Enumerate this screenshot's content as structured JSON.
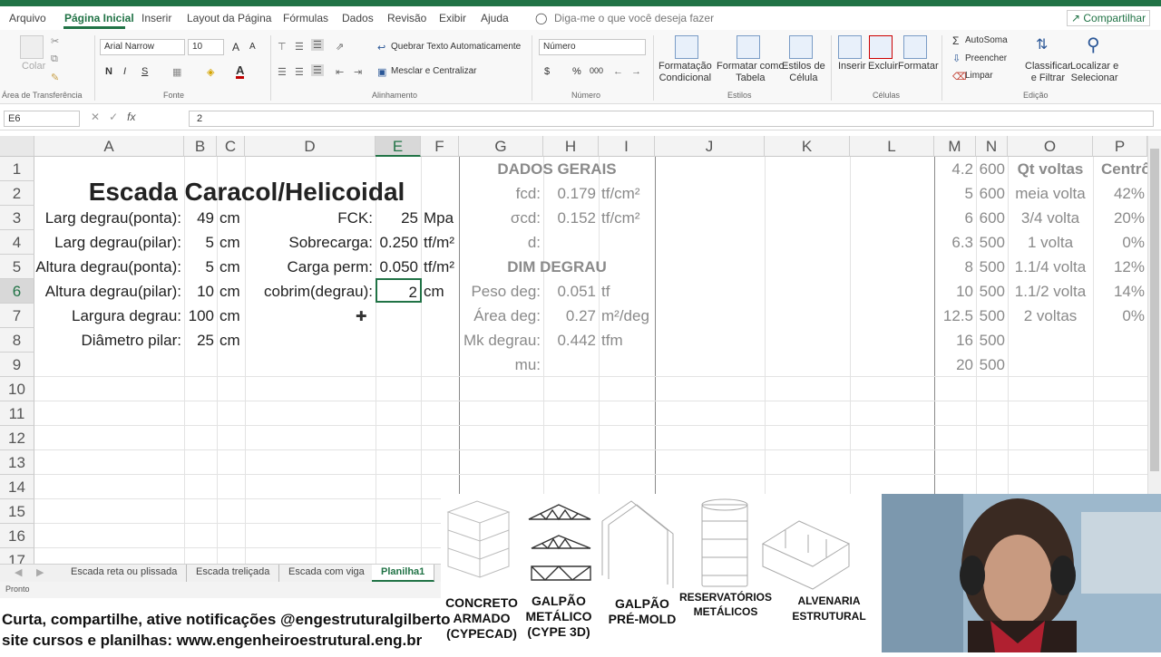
{
  "ribbon_tabs": [
    "Arquivo",
    "Página Inicial",
    "Inserir",
    "Layout da Página",
    "Fórmulas",
    "Dados",
    "Revisão",
    "Exibir",
    "Ajuda"
  ],
  "tell_me": "Diga-me o que você deseja fazer",
  "share": "Compartilhar",
  "clipboard": {
    "paste": "Colar",
    "group": "Área de Transferência"
  },
  "font": {
    "name": "Arial Narrow",
    "size": "10",
    "grow": "A",
    "shrink": "A",
    "bold": "N",
    "italic": "I",
    "underline": "S",
    "color_glyph": "A",
    "group": "Fonte"
  },
  "alignment": {
    "wrap": "Quebrar Texto Automaticamente",
    "merge": "Mesclar e Centralizar",
    "group": "Alinhamento"
  },
  "number": {
    "format": "Número",
    "currency": "$",
    "percent": "%",
    "thousands": "000",
    "group": "Número"
  },
  "styles": {
    "cond": "Formatação\nCondicional",
    "table": "Formatar como\nTabela",
    "cell": "Estilos de\nCélula",
    "group": "Estilos"
  },
  "cells": {
    "insert": "Inserir",
    "delete": "Excluir",
    "format": "Formatar",
    "group": "Células"
  },
  "editing": {
    "autosum": "AutoSoma",
    "fill": "Preencher",
    "clear": "Limpar",
    "sort": "Classificar\ne Filtrar",
    "find": "Localizar e\nSelecionar",
    "group": "Edição"
  },
  "formula_bar": {
    "name_box": "E6",
    "fx": "fx",
    "value": "2"
  },
  "columns": [
    "A",
    "B",
    "C",
    "D",
    "E",
    "F",
    "G",
    "H",
    "I",
    "J",
    "K",
    "L",
    "M",
    "N",
    "O",
    "P"
  ],
  "rows": [
    "1",
    "2",
    "3",
    "4",
    "5",
    "6",
    "7",
    "8",
    "9",
    "10",
    "11",
    "12",
    "13",
    "14",
    "15",
    "16",
    "17"
  ],
  "title": "Escada Caracol/Helicoidal",
  "inputs_left": [
    {
      "label": "Larg degrau(ponta):",
      "value": "49",
      "unit": "cm"
    },
    {
      "label": "Larg degrau(pilar):",
      "value": "5",
      "unit": "cm"
    },
    {
      "label": "Altura degrau(ponta):",
      "value": "5",
      "unit": "cm"
    },
    {
      "label": "Altura degrau(pilar):",
      "value": "10",
      "unit": "cm"
    },
    {
      "label": "Largura degrau:",
      "value": "100",
      "unit": "cm"
    },
    {
      "label": "Diâmetro pilar:",
      "value": "25",
      "unit": "cm"
    }
  ],
  "inputs_right": [
    {
      "label": "FCK:",
      "value": "25",
      "unit": "Mpa"
    },
    {
      "label": "Sobrecarga:",
      "value": "0.250",
      "unit": "tf/m²"
    },
    {
      "label": "Carga perm:",
      "value": "0.050",
      "unit": "tf/m²"
    },
    {
      "label": "cobrim(degrau):",
      "value": "2",
      "unit": "cm"
    }
  ],
  "dados_gerais": {
    "header": "DADOS GERAIS",
    "rows": [
      {
        "label": "fcd:",
        "value": "0.179",
        "unit": "tf/cm²"
      },
      {
        "label": "σcd:",
        "value": "0.152",
        "unit": "tf/cm²"
      },
      {
        "label": "d:",
        "value": "",
        "unit": ""
      }
    ]
  },
  "dim_degrau": {
    "header": "DIM DEGRAU",
    "rows": [
      {
        "label": "Peso deg:",
        "value": "0.051",
        "unit": "tf"
      },
      {
        "label": "Área deg:",
        "value": "0.27",
        "unit": "m²/deg"
      },
      {
        "label": "Mk degrau:",
        "value": "0.442",
        "unit": "tfm"
      },
      {
        "label": "mu:",
        "value": "",
        "unit": ""
      }
    ]
  },
  "table_mn": [
    [
      "4.2",
      "600"
    ],
    [
      "5",
      "600"
    ],
    [
      "6",
      "600"
    ],
    [
      "6.3",
      "500"
    ],
    [
      "8",
      "500"
    ],
    [
      "10",
      "500"
    ],
    [
      "12.5",
      "500"
    ],
    [
      "16",
      "500"
    ],
    [
      "20",
      "500"
    ]
  ],
  "table_op": {
    "header_o": "Qt voltas",
    "header_p": "Centrô",
    "rows": [
      [
        "meia volta",
        "42%"
      ],
      [
        "3/4 volta",
        "20%"
      ],
      [
        "1 volta",
        "0%"
      ],
      [
        "1.1/4 volta",
        "12%"
      ],
      [
        "1.1/2 volta",
        "14%"
      ],
      [
        "2 voltas",
        "0%"
      ]
    ]
  },
  "sheet_tabs": [
    "Escada reta ou plissada",
    "Escada treliçada",
    "Escada com viga",
    "Planilha1"
  ],
  "status": "Pronto",
  "banner": {
    "line1": "Curta, compartilhe, ative notificações @engestruturalgilberto",
    "line2": "site cursos e planilhas: www.engenheiroestrutural.eng.br"
  },
  "promo": [
    "CONCRETO\nARMADO\n(CYPECAD)",
    "GALPÃO\nMETÁLICO\n(CYPE 3D)",
    "GALPÃO\nPRÉ-MOLD",
    "RESERVATÓRIOS\nMETÁLICOS",
    "ALVENARIA\nESTRUTURAL"
  ],
  "colors": {
    "accent": "#217346",
    "grid": "#e3e3e3"
  }
}
